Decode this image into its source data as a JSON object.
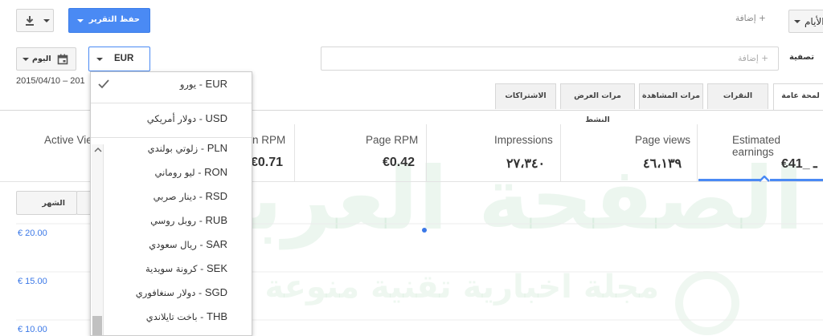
{
  "watermark": {
    "main": "الصفحة العربية",
    "sub": "مجلة اخبارية تقنية منوعة"
  },
  "toolbar": {
    "save_report": "حفظ التقرير",
    "add": "+ إضافة",
    "days_label": "الأيام"
  },
  "date_row": {
    "currency_selected": "EUR",
    "today": "اليوم",
    "date_range_text": "2015/04/10 – 201"
  },
  "filter": {
    "label": "تصفية",
    "placeholder": "+ إضافة"
  },
  "tabs": [
    {
      "label": "لمحة عامة",
      "active": true
    },
    {
      "label": "النقرات",
      "active": false
    },
    {
      "label": "مرات المشاهدة",
      "active": false
    },
    {
      "label": "مرات العرض النشط",
      "active": false
    },
    {
      "label": "الاشتراكات",
      "active": false
    }
  ],
  "metrics": [
    {
      "label": "Estimated earnings",
      "value": "€ـ _41"
    },
    {
      "label": "Page views",
      "value": "٤٦،١٣٩"
    },
    {
      "label": "Impressions",
      "value": "٢٧،٣٤٠"
    },
    {
      "label": "Page RPM",
      "value": "€0.42"
    },
    {
      "label": "n RPM",
      "value": "€0.71"
    },
    {
      "label": "Active Vie",
      "value": ""
    }
  ],
  "period_buttons": {
    "month": "الشهر"
  },
  "chart_data": {
    "type": "line",
    "x": [],
    "series": [],
    "ytick_labels": [
      "€ 20.00",
      "€ 15.00",
      "€ 10.00"
    ],
    "grid": true
  },
  "currency_dropdown": {
    "items": [
      {
        "code": "EUR",
        "name": "يورو",
        "selected": true
      },
      {
        "code": "USD",
        "name": "دولار أمريكي",
        "selected": false
      },
      {
        "code": "PLN",
        "name": "زلوتي بولندي",
        "selected": false
      },
      {
        "code": "RON",
        "name": "ليو روماني",
        "selected": false
      },
      {
        "code": "RSD",
        "name": "دينار صربي",
        "selected": false
      },
      {
        "code": "RUB",
        "name": "روبل روسي",
        "selected": false
      },
      {
        "code": "SAR",
        "name": "ريال سعودي",
        "selected": false
      },
      {
        "code": "SEK",
        "name": "كرونة سويدية",
        "selected": false
      },
      {
        "code": "SGD",
        "name": "دولار سنغافوري",
        "selected": false
      },
      {
        "code": "THB",
        "name": "باخت تايلاندي",
        "selected": false
      }
    ]
  },
  "colors": {
    "accent_blue": "#4a8af4",
    "link_blue": "#3b78e7",
    "chart_point": "#3b78e7"
  }
}
